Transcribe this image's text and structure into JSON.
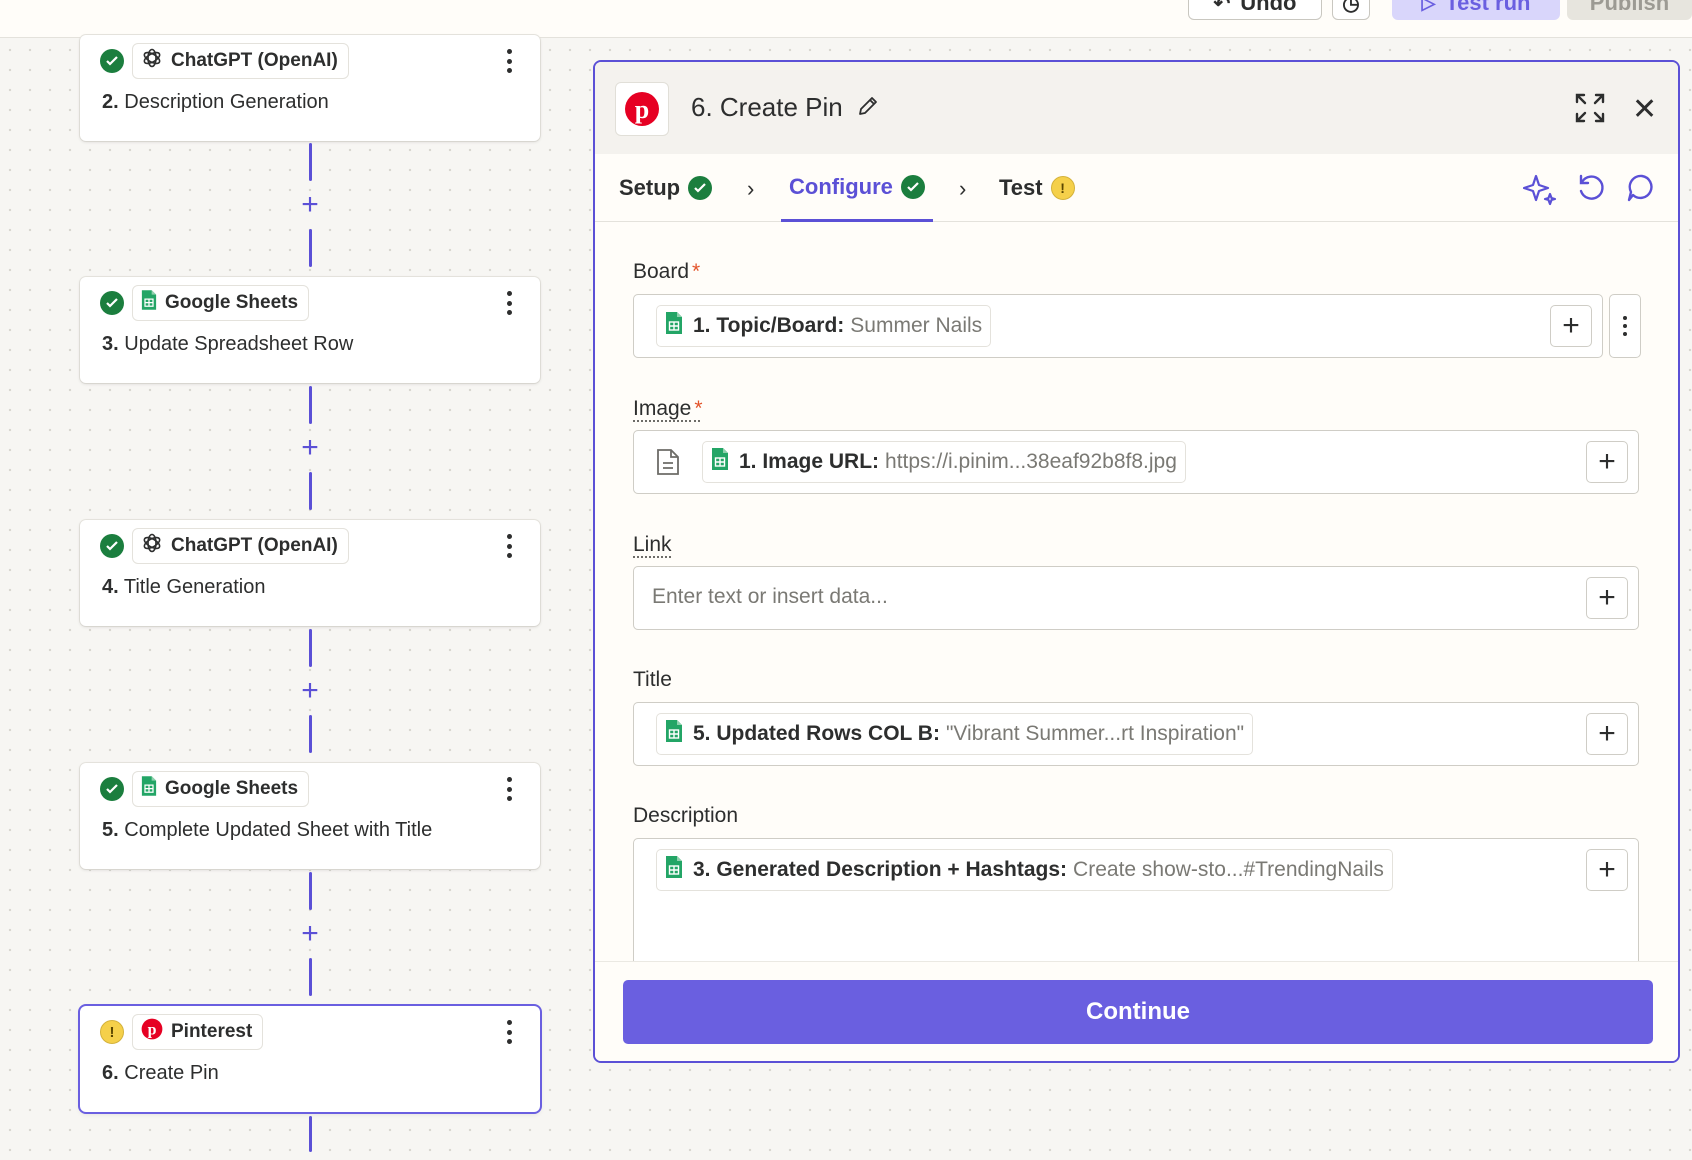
{
  "topbar": {
    "undo_label": "Undo",
    "test_run_label": "Test run",
    "publish_label": "Publish"
  },
  "steps": [
    {
      "app": "ChatGPT (OpenAI)",
      "num": "2.",
      "name": "Description Generation",
      "status": "ok",
      "icon": "openai-icon"
    },
    {
      "app": "Google Sheets",
      "num": "3.",
      "name": "Update Spreadsheet Row",
      "status": "ok",
      "icon": "google-sheets-icon"
    },
    {
      "app": "ChatGPT (OpenAI)",
      "num": "4.",
      "name": "Title Generation",
      "status": "ok",
      "icon": "openai-icon"
    },
    {
      "app": "Google Sheets",
      "num": "5.",
      "name": "Complete Updated Sheet with Title",
      "status": "ok",
      "icon": "google-sheets-icon"
    },
    {
      "app": "Pinterest",
      "num": "6.",
      "name": "Create Pin",
      "status": "warning",
      "icon": "pinterest-icon"
    }
  ],
  "panel": {
    "title": "6. Create Pin",
    "tabs": [
      {
        "label": "Setup",
        "status": "ok"
      },
      {
        "label": "Configure",
        "status": "ok"
      },
      {
        "label": "Test",
        "status": "warning"
      }
    ],
    "fields": {
      "board": {
        "label": "Board",
        "required": "*",
        "chip_key": "1. Topic/Board:",
        "chip_value": "Summer Nails"
      },
      "image": {
        "label": "Image",
        "required": "*",
        "chip_key": "1. Image URL:",
        "chip_value": "https://i.pinim...38eaf92b8f8.jpg"
      },
      "link": {
        "label": "Link",
        "placeholder": "Enter text or insert data..."
      },
      "title": {
        "label": "Title",
        "chip_key": "5. Updated Rows COL B:",
        "chip_value": "\"Vibrant Summer...rt Inspiration\""
      },
      "description": {
        "label": "Description",
        "chip_key": "3. Generated Description + Hashtags:",
        "chip_value": "Create show-sto...#TrendingNails"
      }
    },
    "continue_label": "Continue"
  },
  "colors": {
    "accent": "#5b50d6",
    "button": "#6a5fe0",
    "success": "#1b7e3e",
    "warning": "#f5d04a",
    "required": "#e3542b",
    "sheets_green": "#23a566",
    "pinterest_red": "#e60023"
  }
}
